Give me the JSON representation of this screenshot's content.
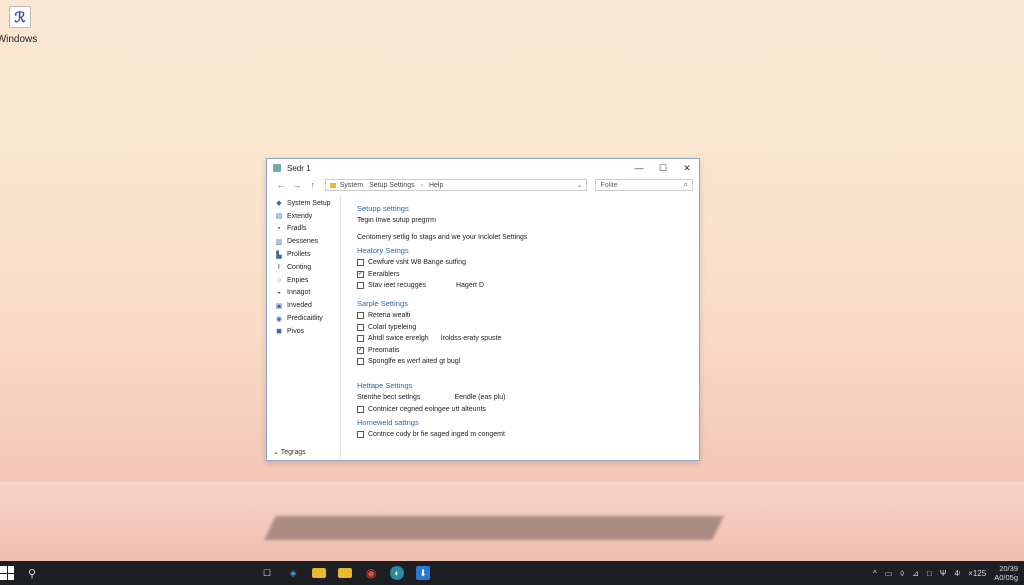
{
  "desktop": {
    "icon_label": "Windows",
    "icon_glyph": "ℛ"
  },
  "window": {
    "title": "Sedr 1",
    "minimize": "—",
    "maximize": "☐",
    "close": "✕",
    "nav": {
      "back": "←",
      "forward": "→",
      "up": "↑"
    },
    "path": [
      "System",
      "Setup Settings",
      "Help"
    ],
    "path_sep": "›",
    "path_drop": "⌄",
    "search_placeholder": "Folite",
    "search_icon": "⌕"
  },
  "sidebar": {
    "items": [
      {
        "label": "System Setup",
        "icon": "◆"
      },
      {
        "label": "Extendy",
        "icon": "▤"
      },
      {
        "label": "Fradls",
        "icon": "▪"
      },
      {
        "label": "Dessenes",
        "icon": "▥"
      },
      {
        "label": "Prollets",
        "icon": "▙"
      },
      {
        "label": "Conting",
        "icon": "ℓ"
      },
      {
        "label": "Enpies",
        "icon": "○"
      },
      {
        "label": "Innagot",
        "icon": "◒"
      },
      {
        "label": "Inveded",
        "icon": "▣"
      },
      {
        "label": "Predicaitlity",
        "icon": "◉"
      },
      {
        "label": "Pivos",
        "icon": "◼"
      }
    ],
    "bottom_label": "Tegrags",
    "bottom_chevron": "⌄"
  },
  "content": {
    "section1": {
      "title": "Setupp settings",
      "lines": [
        "Tegin Inwe sutup pregrrm",
        "Centomery setlig fo stags and we your Inclolet Settings"
      ]
    },
    "section2": {
      "title": "Heatory Setngs",
      "options": [
        {
          "label": "Cewfure vsht W8 Bange sutfing",
          "checked": false,
          "value": ""
        },
        {
          "label": "Eeraiblers",
          "checked": true,
          "value": ""
        },
        {
          "label": "Stav ieet recugges",
          "checked": false,
          "value": "Hagert D"
        }
      ]
    },
    "section3": {
      "title": "Sarple Settings",
      "options": [
        {
          "label": "Reteria wealti",
          "checked": false,
          "value": ""
        },
        {
          "label": "Colarl typeleing",
          "checked": false,
          "value": ""
        },
        {
          "label": "Ahtdl swice enrelgh",
          "checked": false,
          "value": "Iroldss eraty spuste"
        },
        {
          "label": "Preomatis",
          "checked": true,
          "value": ""
        },
        {
          "label": "Sponglfe es werf aited gt bugl",
          "checked": false,
          "value": ""
        }
      ]
    },
    "section4": {
      "title": "Hettape Settings",
      "plain": {
        "label": "Stenthe bect setlngs",
        "value": "Eendle (eas plu)"
      },
      "options": [
        {
          "label": "Contnicer cegned eolngee utt alteunts",
          "checked": false
        }
      ]
    },
    "section5": {
      "title": "Homeweld sattngs",
      "options": [
        {
          "label": "Contrice cudy br fie saged inged m congemt",
          "checked": false
        }
      ]
    }
  },
  "taskbar": {
    "search_icon": "⚲",
    "apps": [
      {
        "glyph": "☐",
        "color": "#1d1f23",
        "fg": "#ddd"
      },
      {
        "glyph": "◈",
        "color": "#1d1f23",
        "fg": "#3ba0e0"
      },
      {
        "glyph": "▬",
        "color": "#e8b830",
        "fg": "#e8b830"
      },
      {
        "glyph": "▬",
        "color": "#e8b830",
        "fg": "#e8b830"
      },
      {
        "glyph": "◉",
        "color": "#1d1f23",
        "fg": "#e04a3a"
      },
      {
        "glyph": "◐",
        "color": "#2a8aa0",
        "fg": "#fff"
      },
      {
        "glyph": "⬇",
        "color": "#2a7ad0",
        "fg": "#fff"
      }
    ],
    "tray": [
      "^",
      "▭",
      "◊",
      "⊿",
      "□",
      "Ψ",
      "4ᵎ",
      "×125"
    ],
    "clock_time": "20/39",
    "clock_date": "A0/05g"
  }
}
